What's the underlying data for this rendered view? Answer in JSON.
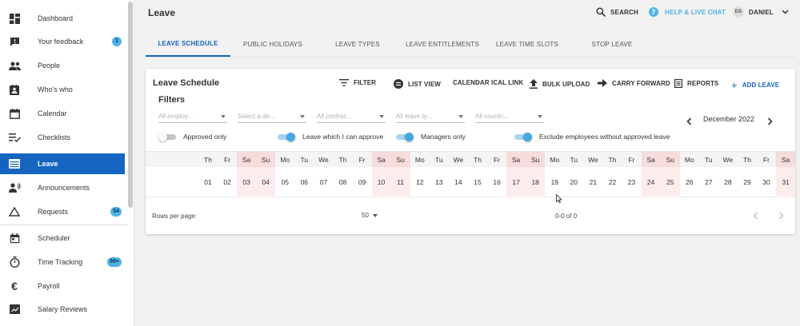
{
  "sidebar": {
    "items": [
      {
        "label": "Dashboard",
        "icon": "dashboard-icon"
      },
      {
        "label": "Your feedback",
        "icon": "feedback-icon",
        "badge": "1"
      },
      {
        "label": "People",
        "icon": "people-icon"
      },
      {
        "label": "Who's who",
        "icon": "contact-card-icon"
      },
      {
        "label": "Calendar",
        "icon": "calendar-icon"
      },
      {
        "label": "Checklists",
        "icon": "checklist-icon"
      },
      {
        "label": "Leave",
        "icon": "leave-icon",
        "active": true
      },
      {
        "label": "Announcements",
        "icon": "announcement-icon"
      },
      {
        "label": "Requests",
        "icon": "requests-icon",
        "badge": "54"
      },
      {
        "label": "Scheduler",
        "icon": "scheduler-icon"
      },
      {
        "label": "Time Tracking",
        "icon": "stopwatch-icon",
        "badge": "99+"
      },
      {
        "label": "Payroll",
        "icon": "euro-icon"
      },
      {
        "label": "Salary Reviews",
        "icon": "salary-review-icon"
      }
    ]
  },
  "header": {
    "title": "Leave",
    "search_label": "SEARCH",
    "help_label": "HELP & LIVE CHAT",
    "user_initials": "DS",
    "user_name": "DANIEL"
  },
  "tabs": [
    "LEAVE SCHEDULE",
    "PUBLIC HOLIDAYS",
    "LEAVE TYPES",
    "LEAVE ENTITLEMENTS",
    "LEAVE TIME SLOTS",
    "STOP LEAVE"
  ],
  "card": {
    "title": "Leave Schedule",
    "toolbar": {
      "filter": "FILTER",
      "list_view": "LIST VIEW",
      "calendar_ical": "CALENDAR ICAL LINK",
      "bulk_upload": "BULK UPLOAD",
      "carry_forward": "CARRY FORWARD",
      "reports": "REPORTS",
      "add_leave": "ADD LEAVE"
    },
    "filters_title": "Filters",
    "filter_placeholders": [
      "All employ...",
      "Select a de...",
      "All contrac...",
      "All leave ty...",
      "All countri..."
    ],
    "month": "December 2022",
    "toggles": [
      {
        "label": "Approved only",
        "on": false
      },
      {
        "label": "Leave which I can approve",
        "on": true
      },
      {
        "label": "Managers only",
        "on": true
      },
      {
        "label": "Exclude employees without approved leave",
        "on": true
      }
    ],
    "calendar": {
      "weekdays": [
        "Th",
        "Fr",
        "Sa",
        "Su",
        "Mo",
        "Tu",
        "We",
        "Th",
        "Fr",
        "Sa",
        "Su",
        "Mo",
        "Tu",
        "We",
        "Th",
        "Fr",
        "Sa",
        "Su",
        "Mo",
        "Tu",
        "We",
        "Th",
        "Fr",
        "Sa",
        "Su",
        "Mo",
        "Tu",
        "We",
        "Th",
        "Fr",
        "Sa"
      ],
      "days": [
        "01",
        "02",
        "03",
        "04",
        "05",
        "06",
        "07",
        "08",
        "09",
        "10",
        "11",
        "12",
        "13",
        "14",
        "15",
        "16",
        "17",
        "18",
        "19",
        "20",
        "21",
        "22",
        "23",
        "24",
        "25",
        "26",
        "27",
        "28",
        "29",
        "30",
        "31"
      ]
    },
    "footer": {
      "rows_per_page_label": "Rows per page:",
      "rows_per_page_value": "50",
      "range": "0-0 of 0"
    }
  },
  "colors": {
    "accent": "#1565c0",
    "badge": "#4fb3e6",
    "weekend_head": "#f6dcdc",
    "weekend_body": "#fcecec",
    "toggle_on": "#47a8dd"
  }
}
